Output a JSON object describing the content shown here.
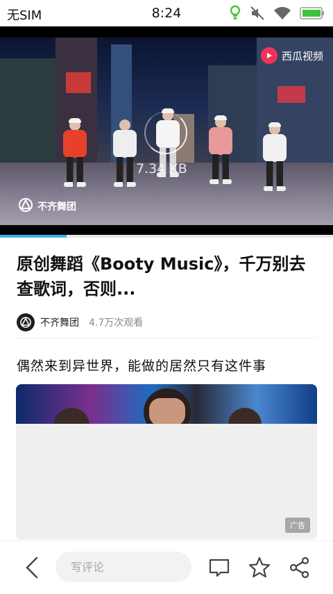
{
  "status_bar": {
    "carrier": "无SIM",
    "time": "8:24",
    "icons": [
      "bulb-icon",
      "mute-icon",
      "wifi-icon",
      "battery-icon"
    ]
  },
  "video": {
    "brand_badge": "西瓜视频",
    "watermark": "不齐舞团",
    "loading_speed": "7.34 KB",
    "progress_fraction": 0.2
  },
  "article": {
    "title": "原创舞蹈《Booty Music》，千万别去查歌词，否则...",
    "author": "不齐舞团",
    "views": "4.7万次观看"
  },
  "recommendation": {
    "title": "偶然来到异世界，能做的居然只有这件事",
    "ad_tag": "广告"
  },
  "bottom_bar": {
    "comment_placeholder": "写评论",
    "icons": [
      "back-arrow-icon",
      "comment-icon",
      "star-icon",
      "share-icon"
    ]
  },
  "colors": {
    "accent": "#3eb0e0",
    "brand": "#f0325a"
  }
}
